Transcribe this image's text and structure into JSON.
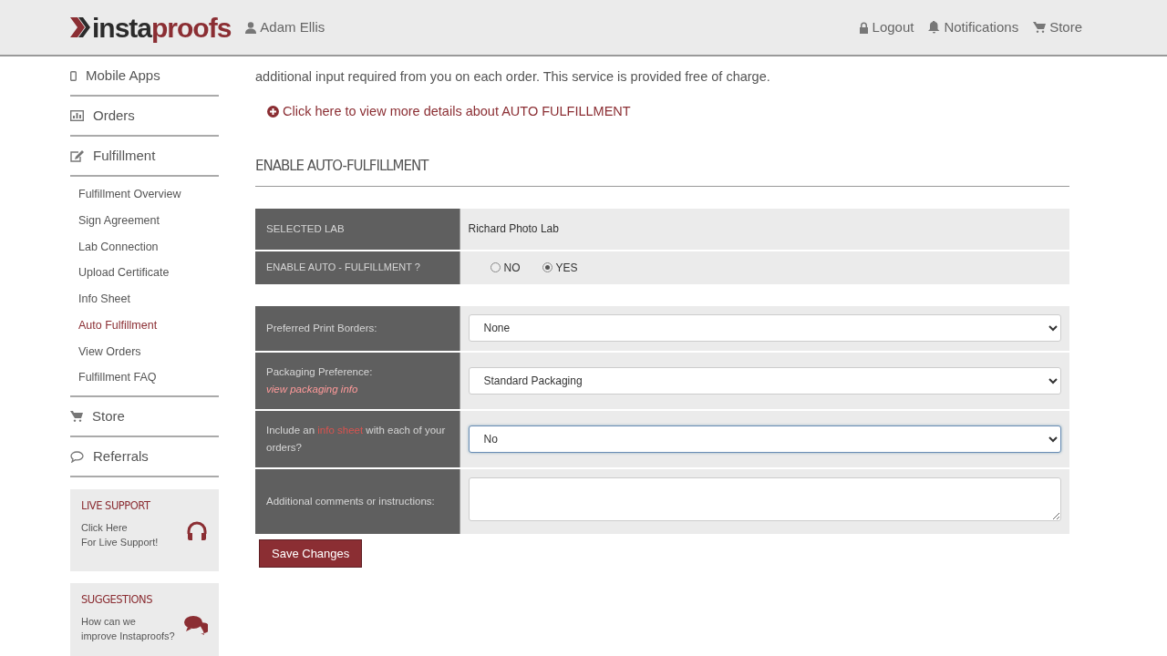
{
  "header": {
    "logo": {
      "first": "insta",
      "second": "proofs"
    },
    "user": "Adam Ellis",
    "links": [
      {
        "label": "Logout",
        "kind": "lock"
      },
      {
        "label": "Notifications",
        "kind": "bell"
      },
      {
        "label": "Store",
        "kind": "cart"
      }
    ]
  },
  "sidebar": {
    "items": [
      {
        "label": "Mobile Apps",
        "kind": "phone"
      },
      {
        "label": "Orders",
        "kind": "chart"
      },
      {
        "label": "Fulfillment",
        "kind": "edit",
        "expanded": true,
        "children": [
          {
            "label": "Fulfillment Overview",
            "selected": false
          },
          {
            "label": "Sign Agreement",
            "selected": false
          },
          {
            "label": "Lab Connection",
            "selected": false
          },
          {
            "label": "Upload Certificate",
            "selected": false
          },
          {
            "label": "Info Sheet",
            "selected": false
          },
          {
            "label": "Auto Fulfillment",
            "selected": true
          },
          {
            "label": "View Orders",
            "selected": false
          },
          {
            "label": "Fulfillment FAQ",
            "selected": false
          }
        ]
      },
      {
        "label": "Store",
        "kind": "cart"
      },
      {
        "label": "Referrals",
        "kind": "chat"
      }
    ],
    "panels": [
      {
        "title": "LIVE SUPPORT",
        "lines": [
          "Click Here",
          "For Live Support!"
        ],
        "kind": "headphones"
      },
      {
        "title": "SUGGESTIONS",
        "lines": [
          "How can we",
          "improve Instaproofs?"
        ],
        "kind": "chat"
      }
    ]
  },
  "intro": "additional input required from you on each order. This service is provided free of charge.",
  "details_link": "Click here to view more details about AUTO FULFILLMENT",
  "section_title": "ENABLE AUTO-FULFILLMENT",
  "lab": {
    "label": "SELECTED LAB",
    "value": "Richard Photo Lab"
  },
  "enable": {
    "label": "ENABLE AUTO - FULFILLMENT ?",
    "options": [
      {
        "label": "NO",
        "selected": false
      },
      {
        "label": "YES",
        "selected": true
      }
    ]
  },
  "fields": [
    {
      "kind": "select",
      "label": "Preferred Print Borders:",
      "value": "None",
      "focused": false
    },
    {
      "kind": "select",
      "label": "Packaging Preference:",
      "link": "view packaging info",
      "value": "Standard Packaging",
      "focused": false
    },
    {
      "kind": "select",
      "label": "Include an **info sheet** with each of your orders?",
      "value": "No",
      "focused": true
    },
    {
      "kind": "textarea",
      "label": "Additional comments or instructions:"
    }
  ],
  "save_button": "Save Changes"
}
